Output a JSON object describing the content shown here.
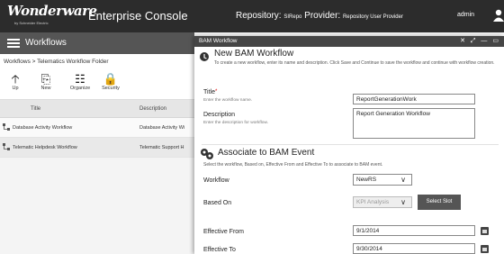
{
  "topbar": {
    "logo_text": "Wonderware",
    "logo_sub": "by Schneider Electric",
    "app_title": "Enterprise Console",
    "repo_label": "Repository:",
    "repo_value": "SIRepo",
    "provider_label": "Provider:",
    "provider_value": "Repository User Provider",
    "user": "admin"
  },
  "left_panel": {
    "title": "Workflows",
    "breadcrumb": "Workflows  >  Telematics Workflow Folder",
    "toolbar": [
      {
        "label": "Up",
        "icon": "arrow-up-icon",
        "glyph": "🡡"
      },
      {
        "label": "New",
        "icon": "new-document-icon",
        "glyph": "⎘"
      },
      {
        "label": "Organize",
        "icon": "organize-icon",
        "glyph": "☷"
      },
      {
        "label": "Security",
        "icon": "lock-icon",
        "glyph": "🔒"
      }
    ],
    "columns": {
      "title": "Title",
      "description": "Description"
    },
    "rows": [
      {
        "name": "Database Activity Workflow",
        "desc": "Database Activity Wi"
      },
      {
        "name": "Telematic Helpdesk Workflow",
        "desc": "Telematic Support H"
      }
    ]
  },
  "dialog": {
    "window_title": "BAM Workflow",
    "controls": "✕ ⤢ — ▭",
    "new_section": {
      "heading": "New BAM Workflow",
      "description": "To create a new workflow, enter its name and description. Click Save and Continue to save the workflow and continue with workflow creation."
    },
    "title_field": {
      "label": "Title",
      "required": "*",
      "hint": "Enter the workflow name.",
      "value": "ReportGenerationWork"
    },
    "description_field": {
      "label": "Description",
      "hint": "Enter the description for workflow.",
      "value": "Report Generation Workflow"
    },
    "assoc_section": {
      "heading": "Associate to BAM Event",
      "description": "Select the workflow, Based on, Effective From and Effective To to associate to BAM event."
    },
    "workflow": {
      "label": "Workflow",
      "value": "NewRS"
    },
    "based_on": {
      "label": "Based On",
      "value": "KPI Analysis",
      "button": "Select Slot"
    },
    "effective_from": {
      "label": "Effective From",
      "value": "9/1/2014"
    },
    "effective_to": {
      "label": "Effective To",
      "value": "9/30/2014"
    }
  }
}
